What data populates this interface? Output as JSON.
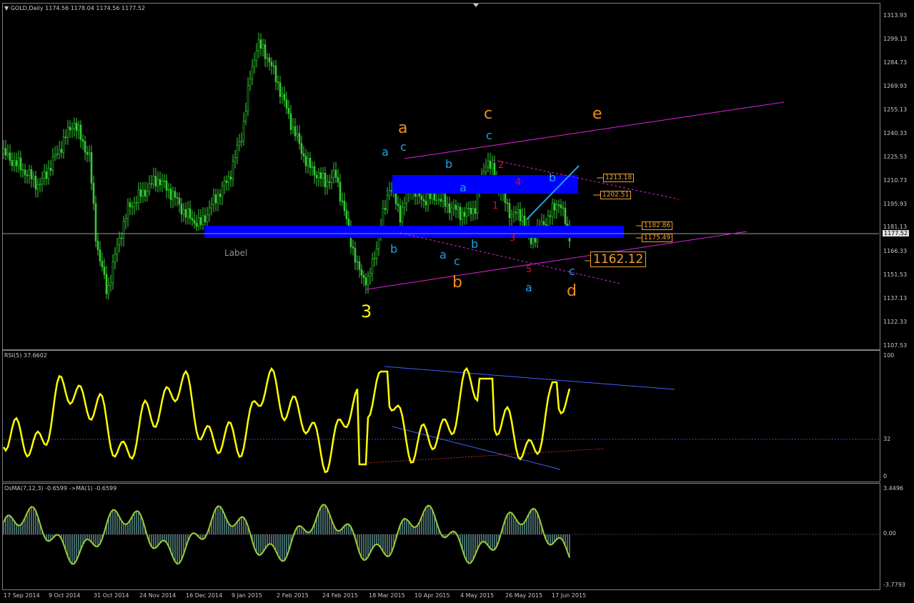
{
  "main": {
    "title_symbol": "GOLD,Daily",
    "ohlc": "1174.56 1178.04 1174.56 1177.52",
    "ticks": [
      "1313.93",
      "1299.13",
      "1284.73",
      "1269.93",
      "1255.13",
      "1240.33",
      "1225.53",
      "1210.73",
      "1195.93",
      "1181.13",
      "1166.33",
      "1151.53",
      "1137.13",
      "1122.33",
      "1107.53"
    ],
    "current_price": "1177.52",
    "label_text": "Label",
    "price_boxes": [
      "1213.18",
      "1202.51",
      "1182.86",
      "1175.49"
    ],
    "target_price": "1162.12",
    "waves": {
      "w3": "3",
      "orange_a": "a",
      "orange_b": "b",
      "orange_c": "c",
      "orange_d": "d",
      "orange_e": "e",
      "blue_a1": "a",
      "blue_c1": "c",
      "blue_b1": "b",
      "blue_b2": "b",
      "blue_a2": "a",
      "blue_a3": "a",
      "blue_c2": "c",
      "blue_b3": "b",
      "blue_c3": "c",
      "blue_b4": "b",
      "blue_a4": "a",
      "blue_c4": "c",
      "red_1": "1",
      "red_2": "2",
      "red_3": "3",
      "red_4": "4",
      "red_5": "5"
    }
  },
  "rsi": {
    "title": "RSI(5) 37.6602",
    "ticks": [
      "100",
      "32",
      "0"
    ]
  },
  "osma": {
    "title": "OsMA(7,12,3) -0.6599  ->MA(1) -0.6599",
    "ticks": [
      "3.4496",
      "0.00",
      "-3.7793"
    ]
  },
  "dates": [
    "17 Sep 2014",
    "9 Oct 2014",
    "31 Oct 2014",
    "24 Nov 2014",
    "16 Dec 2014",
    "9 Jan 2015",
    "2 Feb 2015",
    "24 Feb 2015",
    "18 Mar 2015",
    "10 Apr 2015",
    "4 May 2015",
    "26 May 2015",
    "17 Jun 2015"
  ],
  "colors": {
    "candle": "#32cd32",
    "zone": "#0000ff",
    "channel": "#e020e0",
    "rsi_line": "#ffff00",
    "osma_fill": "#2f4f4f",
    "osma_line": "#9acd32",
    "orange": "#f08c1e",
    "cyan": "#1ea0e8",
    "red": "#c81e1e"
  }
}
